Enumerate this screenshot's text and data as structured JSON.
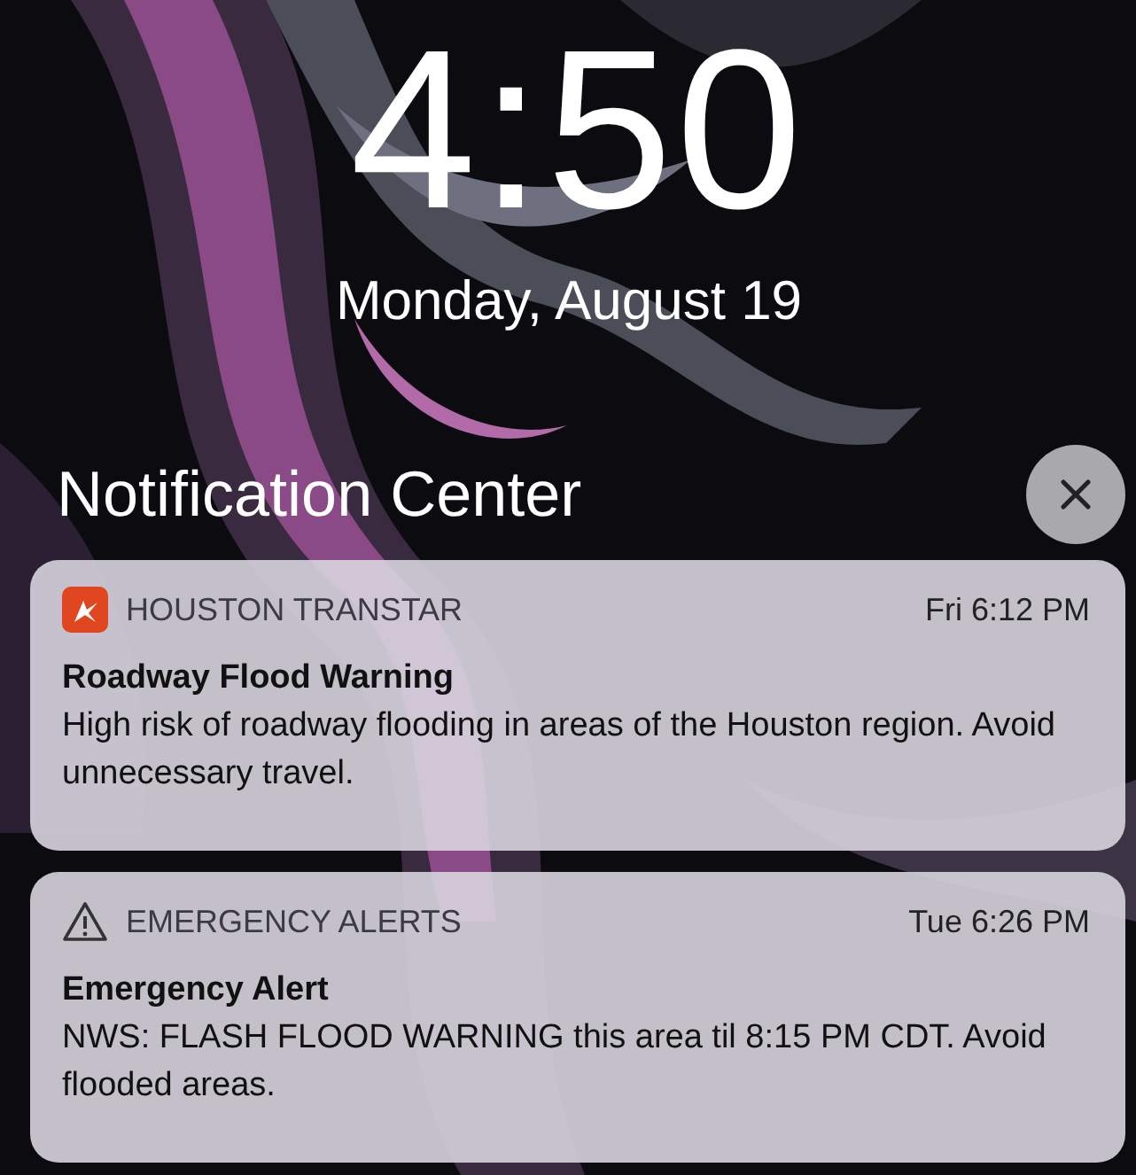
{
  "lock_screen": {
    "time": "4:50",
    "date": "Monday, August 19"
  },
  "notification_center": {
    "title": "Notification Center"
  },
  "notifications": [
    {
      "kind": "app",
      "app": "HOUSTON TRANSTAR",
      "time": "Fri 6:12 PM",
      "title": "Roadway Flood Warning",
      "body": "High risk of roadway flooding in areas of the Houston region. Avoid unnecessary travel."
    },
    {
      "kind": "alert",
      "app": "EMERGENCY ALERTS",
      "time": "Tue 6:26 PM",
      "title": "Emergency Alert",
      "body": "NWS: FLASH FLOOD WARNING this area til 8:15 PM CDT. Avoid flooded areas."
    }
  ]
}
